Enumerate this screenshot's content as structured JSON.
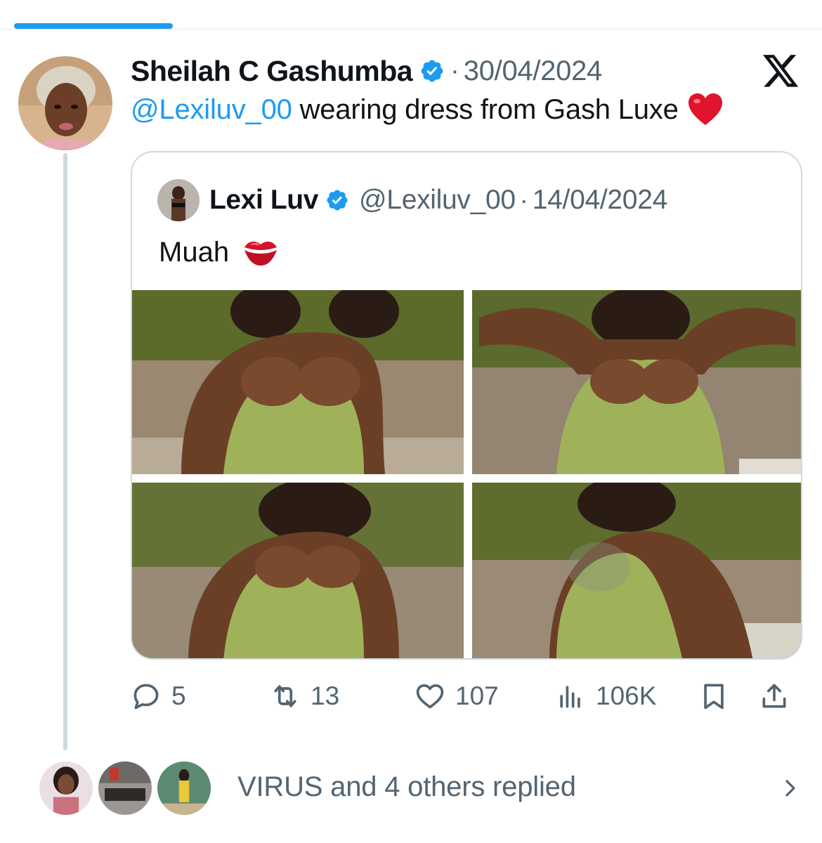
{
  "tweet": {
    "author_name": "Sheilah C Gashumba",
    "separator": "·",
    "date": "30/04/2024",
    "mention": "@Lexiluv_00",
    "text": " wearing dress from Gash Luxe",
    "emoji": "heart",
    "platform_icon": "x-logo-icon"
  },
  "quote": {
    "author_name": "Lexi Luv",
    "handle": "@Lexiluv_00",
    "separator": "·",
    "date": "14/04/2024",
    "text": "Muah",
    "emoji": "kiss-lips",
    "photo_count": 4
  },
  "actions": {
    "replies": "5",
    "retweets": "13",
    "likes": "107",
    "views": "106K"
  },
  "replied_summary": {
    "text": "VIRUS and 4 others replied",
    "avatar_count": 3
  },
  "colors": {
    "accent": "#1d9bf0",
    "secondary_text": "#536471",
    "border": "#cfd9de",
    "heart": "#e0245e"
  }
}
